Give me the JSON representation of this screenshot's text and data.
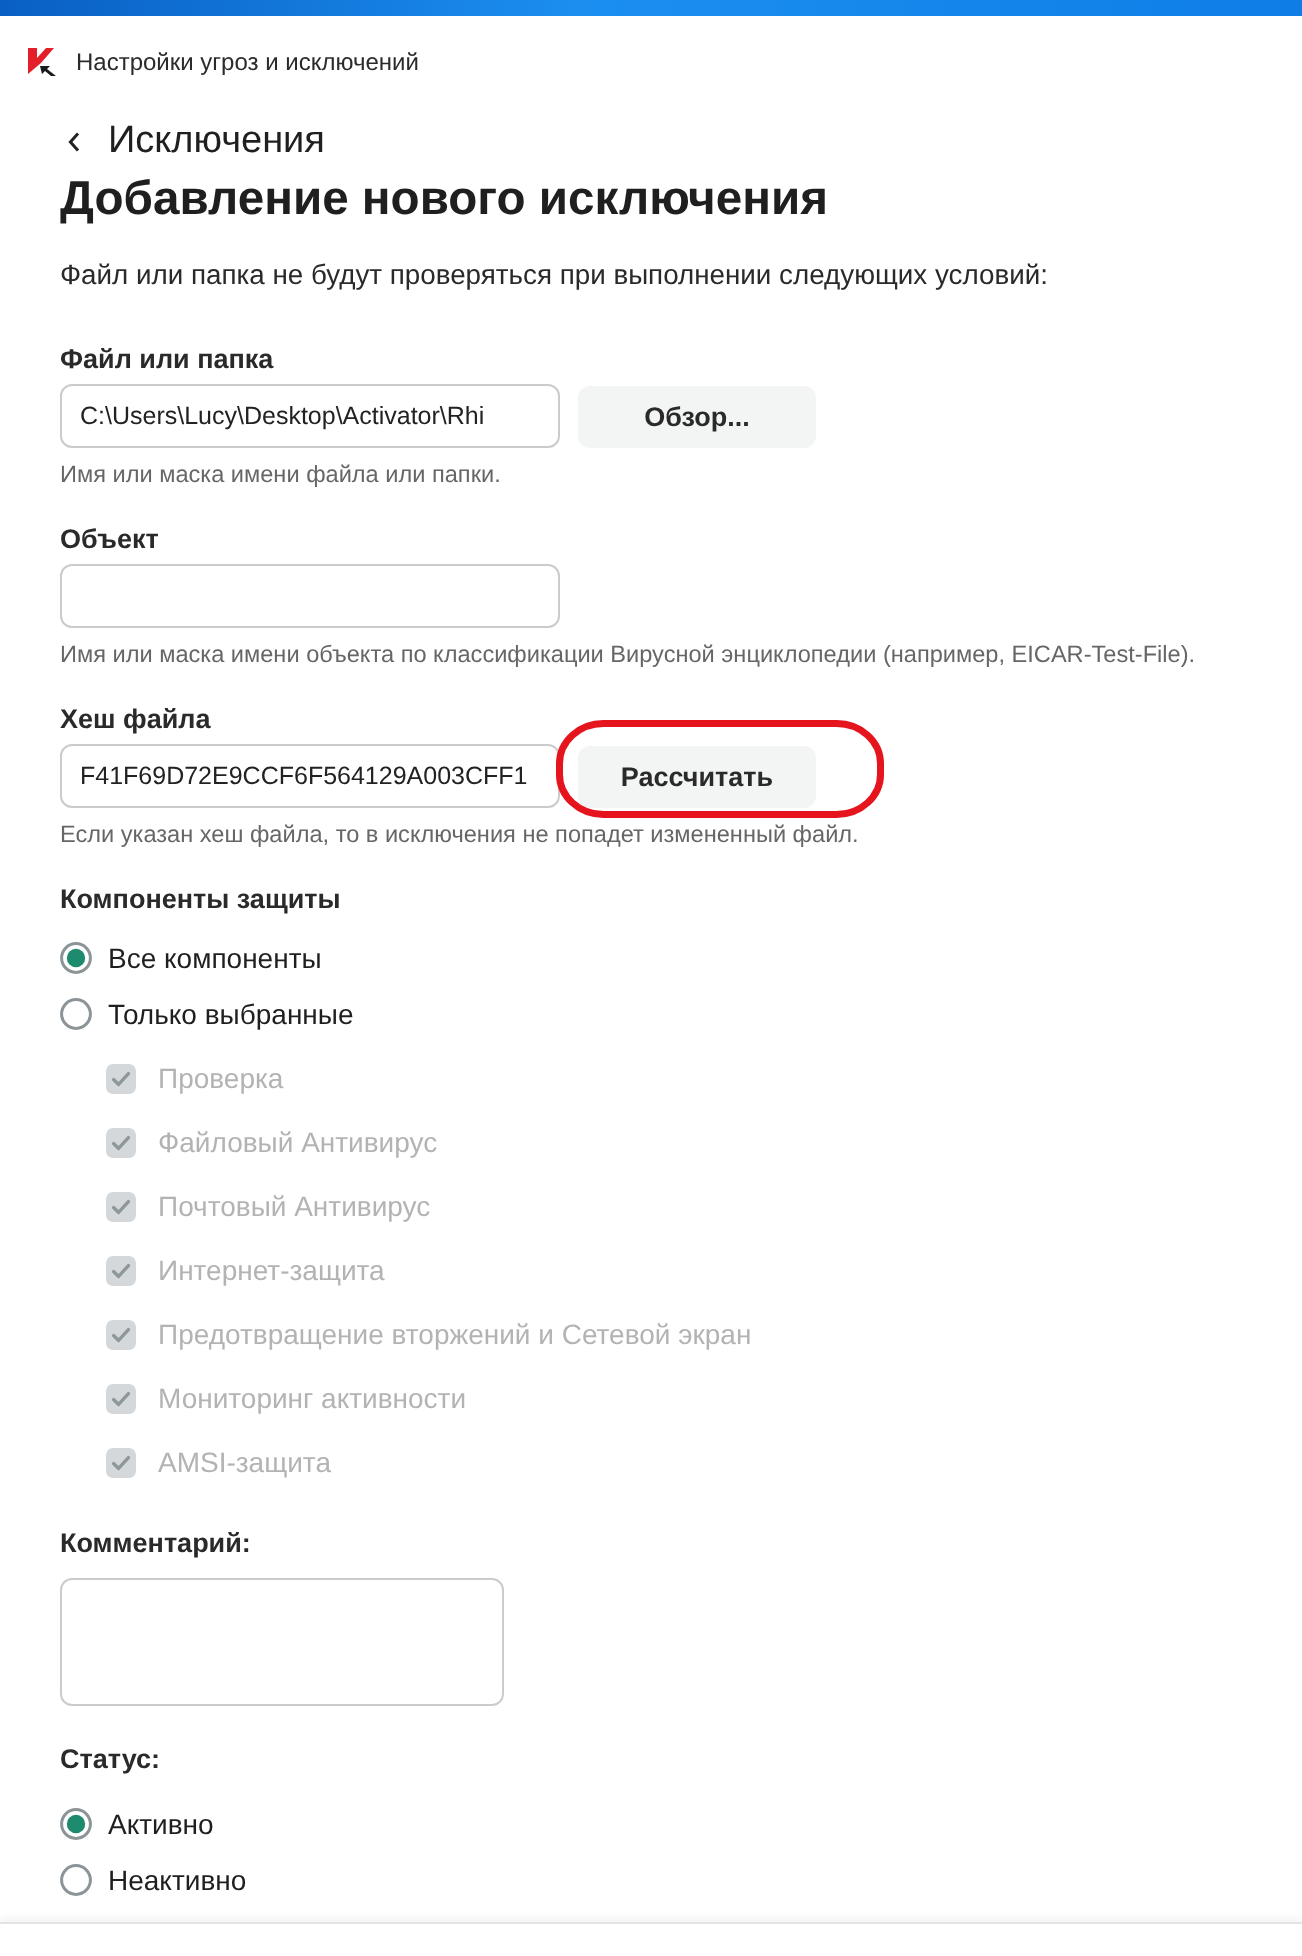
{
  "window": {
    "title": "Настройки угроз и исключений"
  },
  "navigation": {
    "back_label": "Исключения"
  },
  "heading": "Добавление нового исключения",
  "description": "Файл или папка не будут проверяться при выполнении следующих условий:",
  "fields": [
    {
      "kind": "path",
      "label": "Файл или папка",
      "value": "C:\\Users\\Lucy\\Desktop\\Activator\\Rhi",
      "button": "Обзор...",
      "hint": "Имя или маска имени файла или папки."
    },
    {
      "kind": "object",
      "label": "Объект",
      "hint": "Имя или маска имени объекта по классификации Вирусной энциклопедии (например, EICAR-Test-File)."
    },
    {
      "kind": "hash",
      "label": "Хеш файла",
      "value": "F41F69D72E9CCF6F564129A003CFF1",
      "button": "Рассчитать",
      "hint": "Если указан хеш файла, то в исключения не попадет измененный файл.",
      "annotated": true
    }
  ],
  "components": {
    "label": "Компоненты защиты",
    "options": [
      {
        "label": "Все компоненты",
        "selected": true
      },
      {
        "label": "Только выбранные",
        "selected": false
      }
    ],
    "items": [
      {
        "label": "Проверка",
        "checked": true,
        "disabled": true
      },
      {
        "label": "Файловый Антивирус",
        "checked": true,
        "disabled": true
      },
      {
        "label": "Почтовый Антивирус",
        "checked": true,
        "disabled": true
      },
      {
        "label": "Интернет-защита",
        "checked": true,
        "disabled": true
      },
      {
        "label": "Предотвращение вторжений и Сетевой экран",
        "checked": true,
        "disabled": true
      },
      {
        "label": "Мониторинг активности",
        "checked": true,
        "disabled": true
      },
      {
        "label": "AMSI-защита",
        "checked": true,
        "disabled": true
      }
    ]
  },
  "comment": {
    "label": "Комментарий:"
  },
  "status": {
    "label": "Статус:",
    "options": [
      {
        "label": "Активно",
        "selected": true
      },
      {
        "label": "Неактивно",
        "selected": false
      }
    ]
  }
}
